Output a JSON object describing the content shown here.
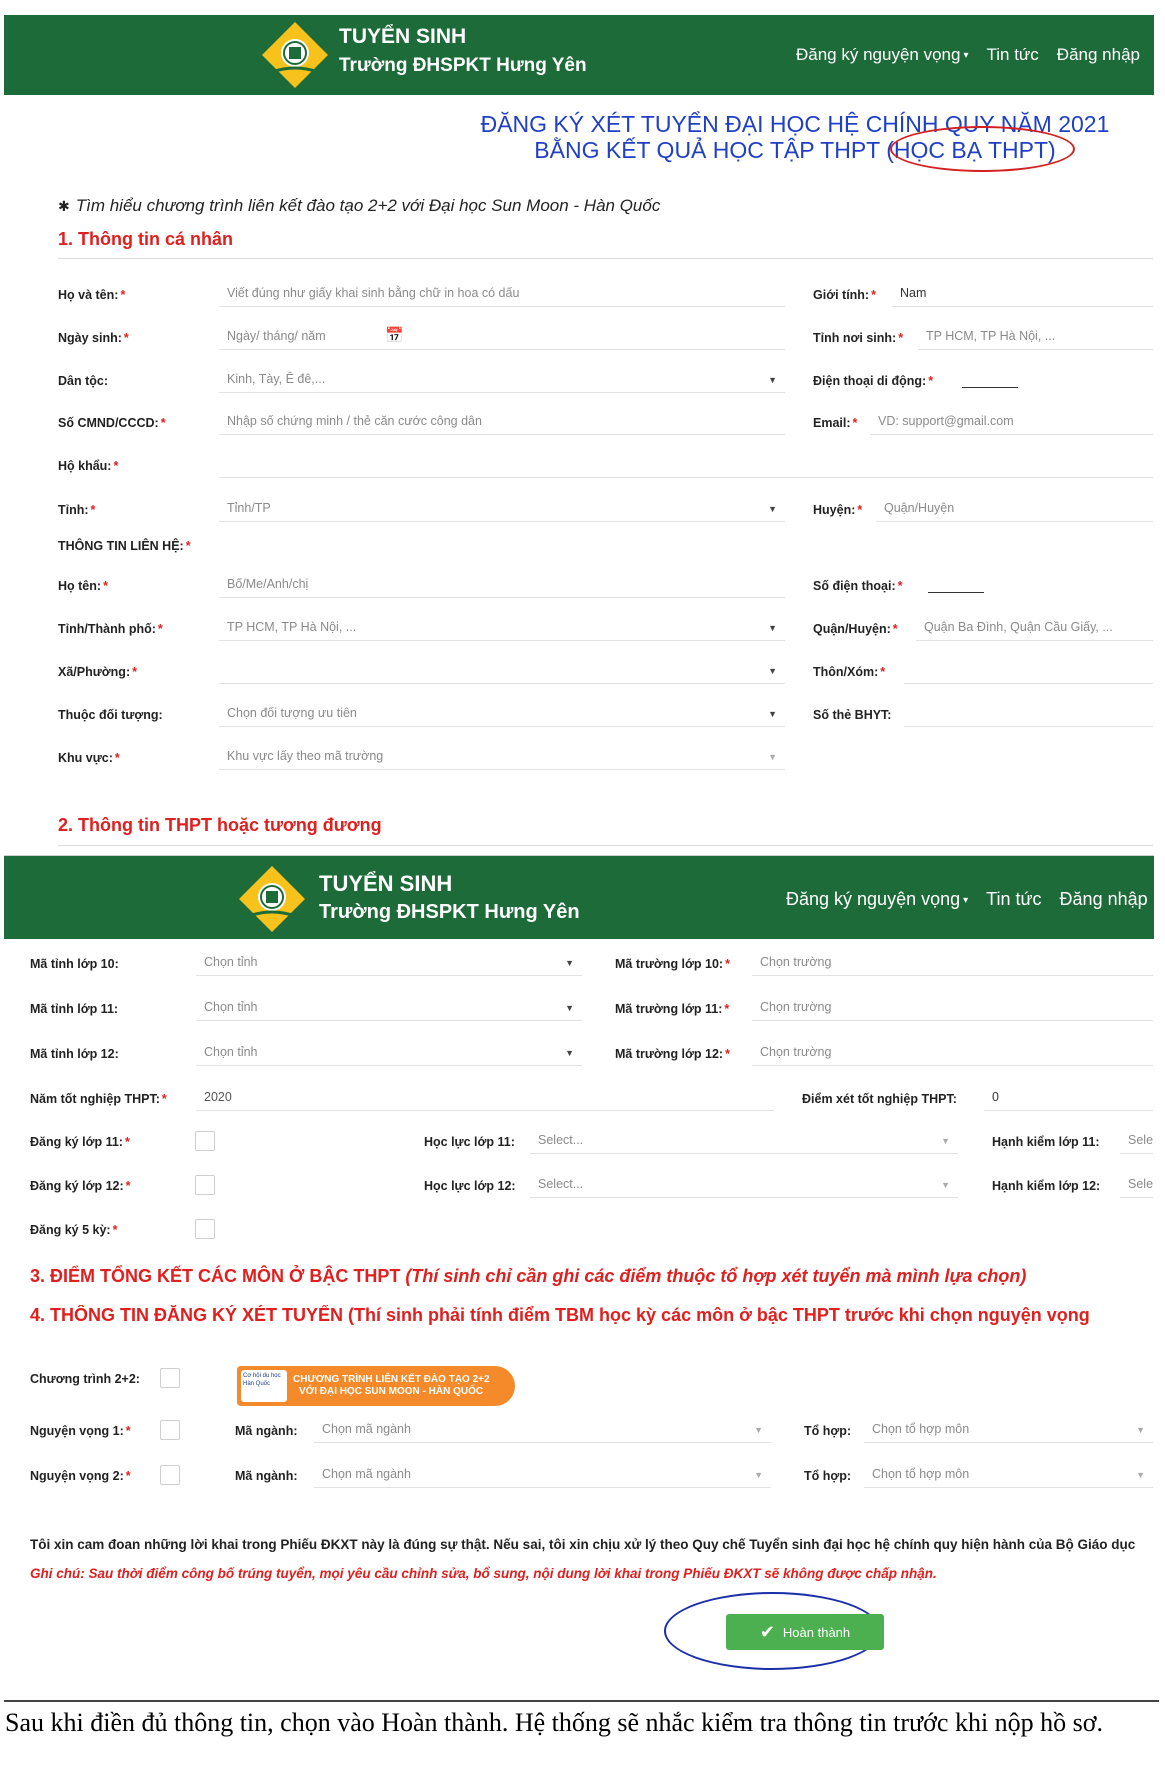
{
  "header": {
    "brand_line1": "TUYỂN SINH",
    "brand_line2": "Trường ĐHSPKT Hưng Yên",
    "nav": [
      "Đăng ký nguyện vọng",
      "Tin tức",
      "Đăng nhập"
    ],
    "colors": {
      "header_bg": "#1e6b3a",
      "title_blue": "#1f3fc6",
      "section_red": "#e01f1f",
      "button_green": "#4caf50"
    }
  },
  "title": {
    "line1": "ĐĂNG KÝ XÉT TUYỂN ĐẠI HỌC HỆ CHÍNH QUY NĂM 2021",
    "line2": "BẰNG KẾT QUẢ HỌC TẬP THPT (HỌC BẠ THPT)"
  },
  "notice": "Tìm hiểu chương trình liên kết đào tạo 2+2 với Đại học Sun Moon - Hàn Quốc",
  "section1": {
    "title": "1. Thông tin cá nhân",
    "fields": {
      "fullname": {
        "label": "Họ và tên:",
        "placeholder": "Viết đúng như giấy khai sinh bằng chữ in hoa có dấu"
      },
      "gender": {
        "label": "Giới tính:",
        "value": "Nam"
      },
      "dob": {
        "label": "Ngày sinh:",
        "placeholder": "Ngày/ tháng/ năm"
      },
      "birthplace": {
        "label": "Tỉnh nơi sinh:",
        "placeholder": "TP HCM, TP Hà Nội, ..."
      },
      "ethnic": {
        "label": "Dân tộc:",
        "placeholder": "Kinh, Tày, Ê đê,..."
      },
      "mobile": {
        "label": "Điện thoại di động:"
      },
      "idcard": {
        "label": "Số CMND/CCCD:",
        "placeholder": "Nhập số chứng minh / thẻ căn cước công dân"
      },
      "email": {
        "label": "Email:",
        "placeholder": "VD: support@gmail.com"
      },
      "household": {
        "label": "Hộ khẩu:"
      },
      "province": {
        "label": "Tỉnh:",
        "placeholder": "Tỉnh/TP"
      },
      "district": {
        "label": "Huyện:",
        "placeholder": "Quận/Huyện"
      },
      "contact_heading": "THÔNG TIN LIÊN HỆ:",
      "contact_name": {
        "label": "Họ tên:",
        "placeholder": "Bố/Me/Anh/chị"
      },
      "contact_phone": {
        "label": "Số điện thoại:"
      },
      "contact_city": {
        "label": "Tỉnh/Thành phố:",
        "placeholder": "TP HCM, TP Hà Nội, ..."
      },
      "contact_district": {
        "label": "Quận/Huyện:",
        "placeholder": "Quận Ba Đình, Quận Cầu Giấy, ..."
      },
      "ward": {
        "label": "Xã/Phường:"
      },
      "hamlet": {
        "label": "Thôn/Xóm:"
      },
      "priority": {
        "label": "Thuộc đối tượng:",
        "placeholder": "Chọn đối tượng ưu tiên"
      },
      "insurance": {
        "label": "Số thẻ BHYT:"
      },
      "zone": {
        "label": "Khu vực:",
        "placeholder": "Khu vực lấy theo mã trường"
      }
    }
  },
  "section2": {
    "title": "2. Thông tin THPT hoặc tương đương",
    "rows": [
      {
        "prov_label": "Mã tỉnh lớp 10:",
        "prov_ph": "Chọn tỉnh",
        "school_label": "Mã trường lớp 10:",
        "school_ph": "Chọn trường"
      },
      {
        "prov_label": "Mã tỉnh lớp 11:",
        "prov_ph": "Chọn tỉnh",
        "school_label": "Mã trường lớp 11:",
        "school_ph": "Chọn trường"
      },
      {
        "prov_label": "Mã tỉnh lớp 12:",
        "prov_ph": "Chọn tỉnh",
        "school_label": "Mã trường lớp 12:",
        "school_ph": "Chọn trường"
      }
    ],
    "grad_year": {
      "label": "Năm tốt nghiệp THPT:",
      "value": "2020"
    },
    "grad_score": {
      "label": "Điểm xét tốt nghiệp THPT:",
      "value": "0"
    },
    "reg11": {
      "label": "Đăng ký lớp 11:",
      "ability_label": "Học lực lớp 11:",
      "ability_ph": "Select...",
      "conduct_label": "Hạnh kiểm lớp 11:",
      "conduct_ph": "Sele"
    },
    "reg12": {
      "label": "Đăng ký lớp 12:",
      "ability_label": "Học lực lớp 12:",
      "ability_ph": "Select...",
      "conduct_label": "Hạnh kiểm lớp 12:",
      "conduct_ph": "Sele"
    },
    "reg5": {
      "label": "Đăng ký 5 kỳ:"
    }
  },
  "section3": {
    "title": "3. ĐIỂM TỔNG KẾT CÁC MÔN Ở BẬC THPT",
    "note": "(Thí sinh chỉ cần ghi các điểm thuộc tổ hợp xét tuyển mà mình lựa chọn)"
  },
  "section4": {
    "title": "4. THÔNG TIN ĐĂNG KÝ XÉT TUYỂN",
    "note": "(Thí sinh phải tính điểm TBM học kỳ các môn ở bậc THPT trước khi chọn nguyện vọng",
    "program": {
      "label": "Chương trình 2+2:"
    },
    "banner": {
      "line1": "CHƯƠNG TRÌNH LIÊN KẾT ĐÀO TẠO 2+2",
      "line2": "VỚI ĐẠI HỌC SUN MOON - HÀN QUỐC",
      "small": "Cơ hội du học Hàn Quốc"
    },
    "choices": [
      {
        "label": "Nguyện vọng 1:",
        "major_label": "Mã ngành:",
        "major_ph": "Chọn mã ngành",
        "combo_label": "Tổ hợp:",
        "combo_ph": "Chọn tổ hợp môn"
      },
      {
        "label": "Nguyện vọng 2:",
        "major_label": "Mã ngành:",
        "major_ph": "Chọn mã ngành",
        "combo_label": "Tổ hợp:",
        "combo_ph": "Chọn tổ hợp môn"
      }
    ]
  },
  "oath": "Tôi xin cam đoan những lời khai trong Phiếu ĐKXT này là đúng sự thật. Nếu sai, tôi xin chịu xử lý theo Quy chế Tuyển sinh đại học hệ chính quy hiện hành của Bộ Giáo dục",
  "note": "Ghi chú: Sau thời điểm công bố trúng tuyển, mọi yêu cầu chỉnh sửa, bổ sung, nội dung lời khai trong Phiếu ĐKXT sẽ không được chấp nhận.",
  "submit_label": "Hoàn thành",
  "caption": "Sau khi điền đủ thông tin, chọn vào Hoàn thành. Hệ thống sẽ nhắc kiểm tra thông tin trước khi nộp hồ sơ."
}
